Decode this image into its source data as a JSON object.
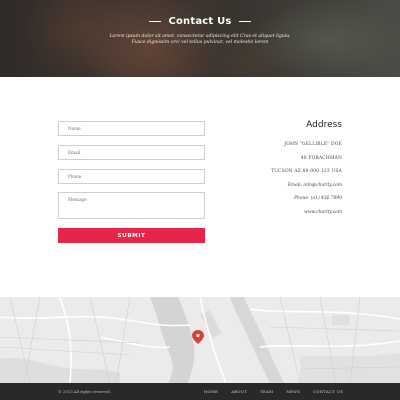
{
  "hero": {
    "title": "Contact Us",
    "subtitle_line1": "Lorem ipsum dolor sit amet, consectetur adipiscing elit Cras et aliquet ligula.",
    "subtitle_line2": "Fusce dignissim orci vel tellus pulvinar, vel molestie lorem"
  },
  "form": {
    "name_placeholder": "Name",
    "email_placeholder": "Email",
    "phone_placeholder": "Phone",
    "message_placeholder": "Message",
    "submit_label": "SUBMIT"
  },
  "address": {
    "heading": "Address",
    "name": "JOHN \"GELLIBLE\" DOE",
    "street": "40 FORACHMAN",
    "city": "TUCSON AZ 88-000-123   USA",
    "email": "Email: info@charity.com",
    "phone": "Phone: (o1) 456 7890",
    "website": "www.charity.com"
  },
  "footer": {
    "copyright": "© 2013 All rights reserved.",
    "nav": [
      "HOME",
      "ABOUT",
      "TEAM",
      "NEWS",
      "CONTACT US"
    ]
  },
  "colors": {
    "accent": "#e7254a",
    "footer_bg": "#292929",
    "map_marker": "#d9423b"
  }
}
